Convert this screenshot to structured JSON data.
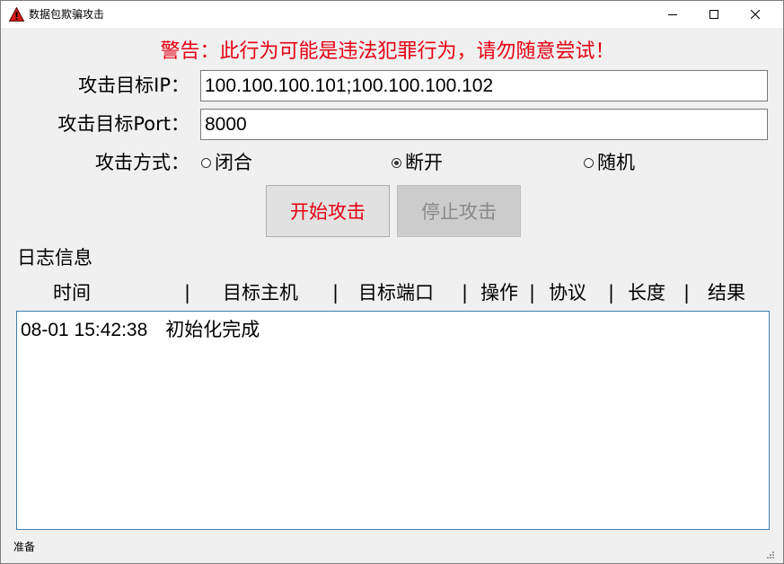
{
  "window": {
    "title": "数据包欺骗攻击",
    "icon": "warning-triangle-icon",
    "controls": [
      "minimize-icon",
      "maximize-icon",
      "close-icon"
    ]
  },
  "warning": {
    "text": "警告：此行为可能是违法犯罪行为，请勿随意尝试！",
    "color": "#e60012"
  },
  "form": {
    "ip_label": "攻击目标IP：",
    "ip_value": "100.100.100.101;100.100.100.102",
    "port_label": "攻击目标Port：",
    "port_value": "8000",
    "mode_label": "攻击方式：",
    "modes": [
      {
        "label": "闭合",
        "checked": false
      },
      {
        "label": "断开",
        "checked": true
      },
      {
        "label": "随机",
        "checked": false
      }
    ]
  },
  "buttons": {
    "start_label": "开始攻击",
    "start_color": "#e60012",
    "stop_label": "停止攻击",
    "stop_enabled": false
  },
  "log": {
    "title": "日志信息",
    "columns": [
      "时间",
      "目标主机",
      "目标端口",
      "操作",
      "协议",
      "长度",
      "结果"
    ],
    "separator": "|",
    "entries": [
      {
        "time": "08-01 15:42:38",
        "message": "初始化完成"
      }
    ]
  },
  "status": {
    "text": "准备"
  }
}
